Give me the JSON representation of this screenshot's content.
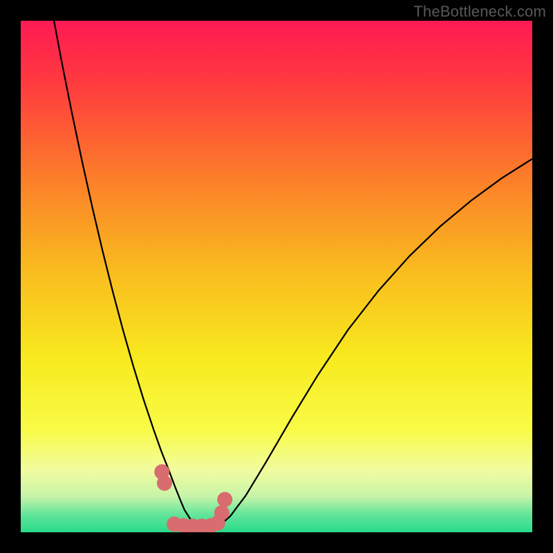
{
  "watermark": "TheBottleneck.com",
  "chart_data": {
    "type": "line",
    "title": "",
    "xlabel": "",
    "ylabel": "",
    "xlim": [
      0,
      100
    ],
    "ylim": [
      0,
      100
    ],
    "grid": false,
    "background_gradient": {
      "stops": [
        {
          "pos": 0.0,
          "color": "#ff1a54"
        },
        {
          "pos": 0.12,
          "color": "#ff3a3f"
        },
        {
          "pos": 0.3,
          "color": "#fc7b2a"
        },
        {
          "pos": 0.48,
          "color": "#f9b91f"
        },
        {
          "pos": 0.66,
          "color": "#f8ea1e"
        },
        {
          "pos": 0.8,
          "color": "#f9fb47"
        },
        {
          "pos": 0.88,
          "color": "#f0fca0"
        },
        {
          "pos": 0.93,
          "color": "#c7f4a8"
        },
        {
          "pos": 0.965,
          "color": "#63e59a"
        },
        {
          "pos": 1.0,
          "color": "#28db8a"
        }
      ]
    },
    "series": [
      {
        "name": "curve",
        "color": "#000000",
        "stroke_width": 2.3,
        "x": [
          6.5,
          8,
          10,
          12,
          14,
          16,
          18,
          20,
          22,
          24,
          26,
          27.5,
          29,
          30.2,
          31.2,
          32,
          33,
          34,
          35,
          36.2,
          37.5,
          39,
          41,
          44,
          48,
          53,
          58,
          64,
          70,
          76,
          82,
          88,
          94,
          100
        ],
        "y": [
          100,
          92,
          82,
          72.5,
          63.5,
          55,
          47,
          39.5,
          32.5,
          26,
          20,
          15.8,
          12,
          8.8,
          6.3,
          4.4,
          2.8,
          1.6,
          0.8,
          0.4,
          0.6,
          1.4,
          3.2,
          7.2,
          13.8,
          22.4,
          30.6,
          39.6,
          47.3,
          54.0,
          59.8,
          64.8,
          69.2,
          73.0
        ]
      },
      {
        "name": "highlight-band",
        "color": "#d86c6e",
        "type": "scatter",
        "marker_radius": 11,
        "x": [
          27.6,
          28.1,
          30.0,
          31.8,
          33.6,
          35.4,
          37.2,
          38.5,
          39.3,
          39.9
        ],
        "y": [
          11.8,
          9.6,
          1.6,
          1.3,
          1.2,
          1.2,
          1.3,
          1.8,
          3.8,
          6.4
        ]
      }
    ]
  }
}
